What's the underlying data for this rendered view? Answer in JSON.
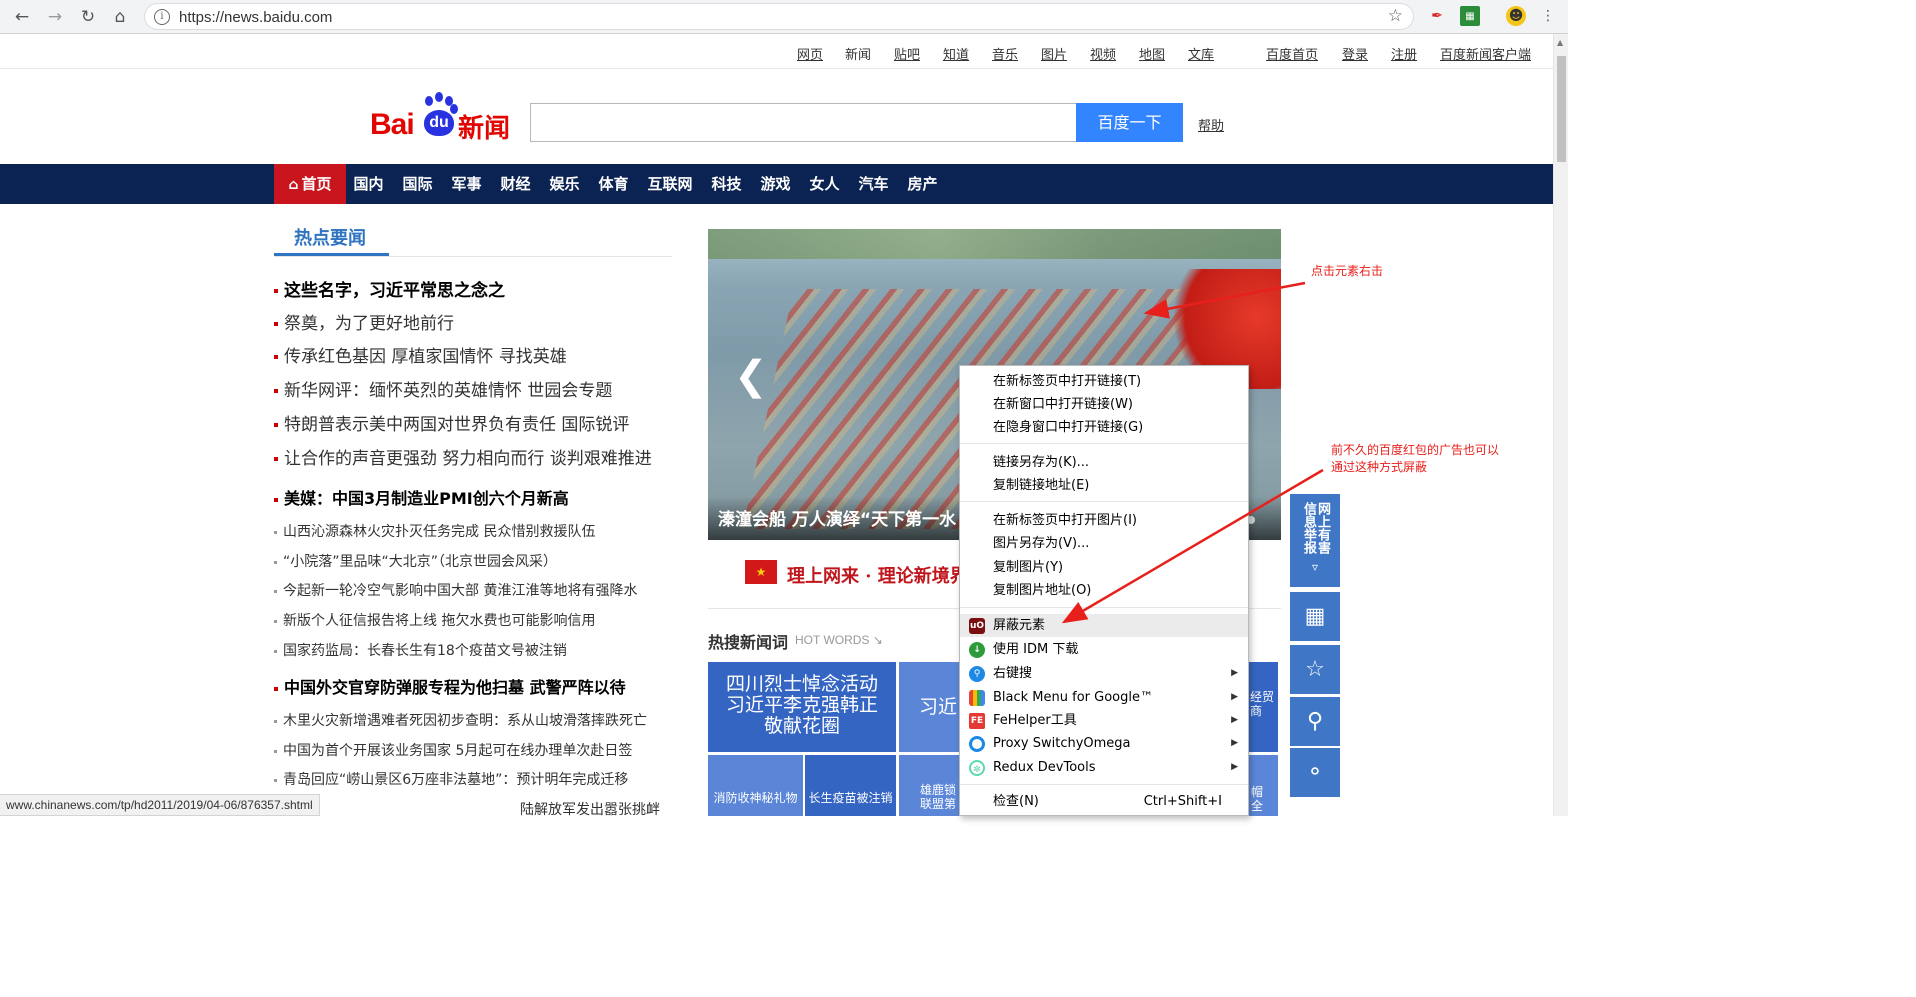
{
  "browser": {
    "url": "https://news.baidu.com",
    "back_icon": "arrow-left-icon",
    "forward_icon": "arrow-right-icon",
    "reload_icon": "reload-icon",
    "home_icon": "home-icon",
    "bookmark_icon": "star-icon"
  },
  "top_links": {
    "webpage": "网页",
    "news": "新闻",
    "tieba": "贴吧",
    "zhidao": "知道",
    "music": "音乐",
    "images": "图片",
    "video": "视频",
    "map": "地图",
    "wenku": "文库",
    "baidu_home": "百度首页",
    "login": "登录",
    "register": "注册",
    "client": "百度新闻客户端"
  },
  "logo": {
    "bai": "Bai",
    "du": "du",
    "xinwen": "新闻"
  },
  "search": {
    "value": "",
    "button": "百度一下",
    "help": "帮助"
  },
  "nav": {
    "home": "首页",
    "items": [
      "国内",
      "国际",
      "军事",
      "财经",
      "娱乐",
      "体育",
      "互联网",
      "科技",
      "游戏",
      "女人",
      "汽车",
      "房产"
    ]
  },
  "hot_news": {
    "title": "热点要闻",
    "group1": [
      "这些名字，习近平常思之念之",
      "祭奠，为了更好地前行",
      "传承红色基因 厚植家国情怀 寻找英雄",
      "新华网评：缅怀英烈的英雄情怀  世园会专题",
      "特朗普表示美中两国对世界负有责任 国际锐评",
      "让合作的声音更强劲  努力相向而行  谈判艰难推进"
    ],
    "headline2": "美媒：中国3月制造业PMI创六个月新高",
    "group2": [
      "山西沁源森林火灾扑灭任务完成 民众惜别救援队伍",
      "“小院落”里品味“大北京”（北京世园会风采）",
      "今起新一轮冷空气影响中国大部 黄淮江淮等地将有强降水",
      "新版个人征信报告将上线 拖欠水费也可能影响信用",
      "国家药监局：长春长生有18个疫苗文号被注销"
    ],
    "headline3": "中国外交官穿防弹服专程为他扫墓 武警严阵以待",
    "group3": [
      "木里火灾新增遇难者死因初步查明：系从山坡滑落摔跌死亡",
      "中国为首个开展该业务国家 5月起可在线办理单次赴日签",
      "青岛回应“崂山景区6万座非法墓地”：预计明年完成迁移"
    ]
  },
  "carousel": {
    "caption": "溱潼会船 万人演绎“天下第一水",
    "prev_icon": "chevron-left-icon"
  },
  "banner": {
    "text": "理上网来 · 理论新境界"
  },
  "hot_search": {
    "title": "热搜新闻词",
    "subtitle": "HOT WORDS ↘",
    "tile_main": [
      "四川烈士悼念活动",
      "习近平李克强韩正",
      "敬献花圈"
    ],
    "tile_second": "习近",
    "tile_right": [
      "经贸",
      "商"
    ],
    "small_tiles": [
      "消防收神秘礼物",
      "长生疫苗被注销",
      "雄鹿锁",
      "联盟第",
      "帽",
      "全"
    ]
  },
  "context_menu": {
    "items": [
      "在新标签页中打开链接(T)",
      "在新窗口中打开链接(W)",
      "在隐身窗口中打开链接(G)",
      "链接另存为(K)...",
      "复制链接地址(E)",
      "在新标签页中打开图片(I)",
      "图片另存为(V)...",
      "复制图片(Y)",
      "复制图片地址(O)",
      "屏蔽元素",
      "使用 IDM 下载",
      "右键搜",
      "Black Menu for Google™",
      "FeHelper工具",
      "Proxy SwitchyOmega",
      "Redux DevTools",
      "检查(N)"
    ],
    "inspect_shortcut": "Ctrl+Shift+I",
    "ublock_badge": "uO",
    "fehelper_badge": "FE"
  },
  "widgets": {
    "report": "网上有害信息举报",
    "report_icon": "chevron-down-circle-icon",
    "qr_icon": "qr-code-icon",
    "star_icon": "star-icon",
    "search_icon": "search-icon",
    "help_icon": "question-icon"
  },
  "annotations": {
    "note1": "点击元素右击",
    "note2_line1": "前不久的百度红包的广告也可以",
    "note2_line2": "通过这种方式屏蔽",
    "color": "#e8201c"
  },
  "status_bar": {
    "text": "www.chinanews.com/tp/hd2011/2019/04-06/876357.shtml"
  },
  "ticker": {
    "text": "陆解放军发出嚣张挑衅"
  },
  "colors": {
    "nav_bg": "#0b2352",
    "home_red": "#c9151e",
    "search_blue": "#3385ff",
    "tile_blue": "#3565c2"
  }
}
